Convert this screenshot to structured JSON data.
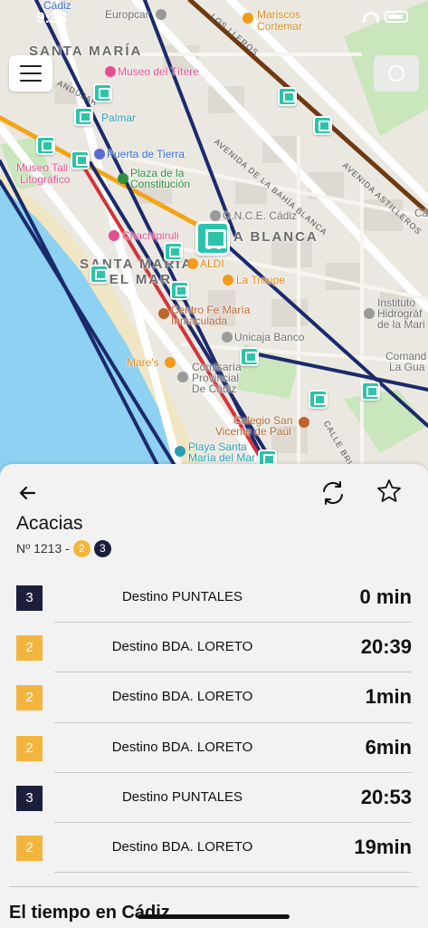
{
  "status_bar": {
    "time": "9:38"
  },
  "map": {
    "district_labels": [
      "SANTA MARÍA",
      "SANTA MARÍA DEL MAR",
      "LA BLANCA"
    ],
    "district_label_lines": {
      "santa_maria_del_mar_1": "SANTA MARÍA",
      "santa_maria_del_mar_2": "DEL MAR",
      "la_blanca": "A BLANCA"
    },
    "streets": [
      "AVENIDA DE LA BAHÍA BLANCA",
      "AVENIDA ASTILLEROS",
      "CALLE BRUNETE",
      "ANDUJAR",
      "LOS LLEROS"
    ],
    "pois": {
      "cadiz_top": "Cádiz",
      "europcar": "Europcar",
      "mariscos_line1": "Mariscos",
      "mariscos_line2": "Cortemar",
      "museo_titere": "Museo del Títere",
      "palmar": "Palmar",
      "puerta_tierra": "Puerta de Tierra",
      "plaza_line1": "Plaza de la",
      "plaza_line2": "Constitución",
      "museo_tali_line1": "Museo Tali",
      "museo_tali_line2": "Litográfico",
      "once": "O.N.C.E. Cádiz",
      "chachipiruli": "Chachipiruli",
      "aldi": "ALDI",
      "la_troupe": "La Troupe",
      "centro_line1": "Centro Fe María",
      "centro_line2": "Inmaculada",
      "unicaja": "Unicaja Banco",
      "instituto_line1": "Instituto",
      "instituto_line2": "Hidrográf",
      "instituto_line3": "de la Mari",
      "comand_line1": "Comand",
      "comand_line2": "La Gua",
      "mares": "Mare's",
      "comisaria_line1": "Comisaría",
      "comisaria_line2": "Provincial",
      "comisaria_line3": "De Cádiz",
      "colegio_line1": "Colegio San",
      "colegio_line2": "Vicente de Paúl",
      "playa_line1": "Playa Santa",
      "playa_line2": "María del Mar",
      "cadiz_right": "Cádiz"
    },
    "colors": {
      "line_navy": "#1a2a6c",
      "line_red": "#d3343a",
      "line_orange": "#f2a516",
      "line_brown": "#6e3a12",
      "stop_teal": "#2bc4aa",
      "sea": "#8ed1f2"
    },
    "icons": [
      "menu-icon",
      "locate-icon",
      "bus-stop-icon"
    ]
  },
  "stop": {
    "name": "Acacias",
    "number": "Nº 1213 -",
    "lines": [
      {
        "label": "2",
        "color": "#f4b53f"
      },
      {
        "label": "3",
        "color": "#1c1f3b"
      }
    ]
  },
  "arrivals": [
    {
      "line": "3",
      "color": "#1c1f3b",
      "destination": "Destino PUNTALES",
      "time": "0 min"
    },
    {
      "line": "2",
      "color": "#f4b53f",
      "destination": "Destino BDA. LORETO",
      "time": "20:39"
    },
    {
      "line": "2",
      "color": "#f4b53f",
      "destination": "Destino BDA. LORETO",
      "time": "1min"
    },
    {
      "line": "2",
      "color": "#f4b53f",
      "destination": "Destino BDA. LORETO",
      "time": "6min"
    },
    {
      "line": "3",
      "color": "#1c1f3b",
      "destination": "Destino PUNTALES",
      "time": "20:53"
    },
    {
      "line": "2",
      "color": "#f4b53f",
      "destination": "Destino BDA. LORETO",
      "time": "19min"
    }
  ],
  "weather": {
    "title": "El tiempo en Cádiz"
  },
  "icons": {
    "back": "arrow-left-icon",
    "refresh": "refresh-icon",
    "favorite": "star-outline-icon"
  }
}
